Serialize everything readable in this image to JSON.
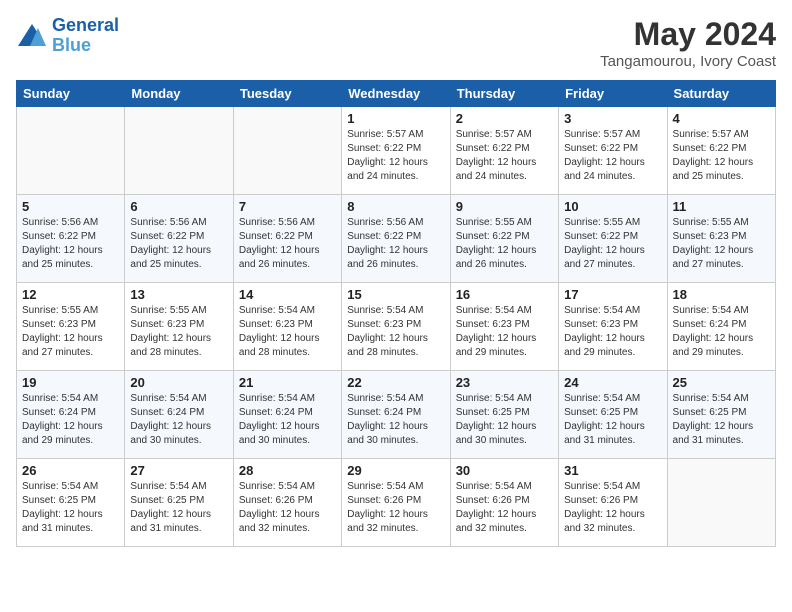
{
  "logo": {
    "line1": "General",
    "line2": "Blue"
  },
  "title": {
    "month_year": "May 2024",
    "location": "Tangamourou, Ivory Coast"
  },
  "weekdays": [
    "Sunday",
    "Monday",
    "Tuesday",
    "Wednesday",
    "Thursday",
    "Friday",
    "Saturday"
  ],
  "weeks": [
    [
      {
        "day": "",
        "sunrise": "",
        "sunset": "",
        "daylight": ""
      },
      {
        "day": "",
        "sunrise": "",
        "sunset": "",
        "daylight": ""
      },
      {
        "day": "",
        "sunrise": "",
        "sunset": "",
        "daylight": ""
      },
      {
        "day": "1",
        "sunrise": "Sunrise: 5:57 AM",
        "sunset": "Sunset: 6:22 PM",
        "daylight": "Daylight: 12 hours and 24 minutes."
      },
      {
        "day": "2",
        "sunrise": "Sunrise: 5:57 AM",
        "sunset": "Sunset: 6:22 PM",
        "daylight": "Daylight: 12 hours and 24 minutes."
      },
      {
        "day": "3",
        "sunrise": "Sunrise: 5:57 AM",
        "sunset": "Sunset: 6:22 PM",
        "daylight": "Daylight: 12 hours and 24 minutes."
      },
      {
        "day": "4",
        "sunrise": "Sunrise: 5:57 AM",
        "sunset": "Sunset: 6:22 PM",
        "daylight": "Daylight: 12 hours and 25 minutes."
      }
    ],
    [
      {
        "day": "5",
        "sunrise": "Sunrise: 5:56 AM",
        "sunset": "Sunset: 6:22 PM",
        "daylight": "Daylight: 12 hours and 25 minutes."
      },
      {
        "day": "6",
        "sunrise": "Sunrise: 5:56 AM",
        "sunset": "Sunset: 6:22 PM",
        "daylight": "Daylight: 12 hours and 25 minutes."
      },
      {
        "day": "7",
        "sunrise": "Sunrise: 5:56 AM",
        "sunset": "Sunset: 6:22 PM",
        "daylight": "Daylight: 12 hours and 26 minutes."
      },
      {
        "day": "8",
        "sunrise": "Sunrise: 5:56 AM",
        "sunset": "Sunset: 6:22 PM",
        "daylight": "Daylight: 12 hours and 26 minutes."
      },
      {
        "day": "9",
        "sunrise": "Sunrise: 5:55 AM",
        "sunset": "Sunset: 6:22 PM",
        "daylight": "Daylight: 12 hours and 26 minutes."
      },
      {
        "day": "10",
        "sunrise": "Sunrise: 5:55 AM",
        "sunset": "Sunset: 6:22 PM",
        "daylight": "Daylight: 12 hours and 27 minutes."
      },
      {
        "day": "11",
        "sunrise": "Sunrise: 5:55 AM",
        "sunset": "Sunset: 6:23 PM",
        "daylight": "Daylight: 12 hours and 27 minutes."
      }
    ],
    [
      {
        "day": "12",
        "sunrise": "Sunrise: 5:55 AM",
        "sunset": "Sunset: 6:23 PM",
        "daylight": "Daylight: 12 hours and 27 minutes."
      },
      {
        "day": "13",
        "sunrise": "Sunrise: 5:55 AM",
        "sunset": "Sunset: 6:23 PM",
        "daylight": "Daylight: 12 hours and 28 minutes."
      },
      {
        "day": "14",
        "sunrise": "Sunrise: 5:54 AM",
        "sunset": "Sunset: 6:23 PM",
        "daylight": "Daylight: 12 hours and 28 minutes."
      },
      {
        "day": "15",
        "sunrise": "Sunrise: 5:54 AM",
        "sunset": "Sunset: 6:23 PM",
        "daylight": "Daylight: 12 hours and 28 minutes."
      },
      {
        "day": "16",
        "sunrise": "Sunrise: 5:54 AM",
        "sunset": "Sunset: 6:23 PM",
        "daylight": "Daylight: 12 hours and 29 minutes."
      },
      {
        "day": "17",
        "sunrise": "Sunrise: 5:54 AM",
        "sunset": "Sunset: 6:23 PM",
        "daylight": "Daylight: 12 hours and 29 minutes."
      },
      {
        "day": "18",
        "sunrise": "Sunrise: 5:54 AM",
        "sunset": "Sunset: 6:24 PM",
        "daylight": "Daylight: 12 hours and 29 minutes."
      }
    ],
    [
      {
        "day": "19",
        "sunrise": "Sunrise: 5:54 AM",
        "sunset": "Sunset: 6:24 PM",
        "daylight": "Daylight: 12 hours and 29 minutes."
      },
      {
        "day": "20",
        "sunrise": "Sunrise: 5:54 AM",
        "sunset": "Sunset: 6:24 PM",
        "daylight": "Daylight: 12 hours and 30 minutes."
      },
      {
        "day": "21",
        "sunrise": "Sunrise: 5:54 AM",
        "sunset": "Sunset: 6:24 PM",
        "daylight": "Daylight: 12 hours and 30 minutes."
      },
      {
        "day": "22",
        "sunrise": "Sunrise: 5:54 AM",
        "sunset": "Sunset: 6:24 PM",
        "daylight": "Daylight: 12 hours and 30 minutes."
      },
      {
        "day": "23",
        "sunrise": "Sunrise: 5:54 AM",
        "sunset": "Sunset: 6:25 PM",
        "daylight": "Daylight: 12 hours and 30 minutes."
      },
      {
        "day": "24",
        "sunrise": "Sunrise: 5:54 AM",
        "sunset": "Sunset: 6:25 PM",
        "daylight": "Daylight: 12 hours and 31 minutes."
      },
      {
        "day": "25",
        "sunrise": "Sunrise: 5:54 AM",
        "sunset": "Sunset: 6:25 PM",
        "daylight": "Daylight: 12 hours and 31 minutes."
      }
    ],
    [
      {
        "day": "26",
        "sunrise": "Sunrise: 5:54 AM",
        "sunset": "Sunset: 6:25 PM",
        "daylight": "Daylight: 12 hours and 31 minutes."
      },
      {
        "day": "27",
        "sunrise": "Sunrise: 5:54 AM",
        "sunset": "Sunset: 6:25 PM",
        "daylight": "Daylight: 12 hours and 31 minutes."
      },
      {
        "day": "28",
        "sunrise": "Sunrise: 5:54 AM",
        "sunset": "Sunset: 6:26 PM",
        "daylight": "Daylight: 12 hours and 32 minutes."
      },
      {
        "day": "29",
        "sunrise": "Sunrise: 5:54 AM",
        "sunset": "Sunset: 6:26 PM",
        "daylight": "Daylight: 12 hours and 32 minutes."
      },
      {
        "day": "30",
        "sunrise": "Sunrise: 5:54 AM",
        "sunset": "Sunset: 6:26 PM",
        "daylight": "Daylight: 12 hours and 32 minutes."
      },
      {
        "day": "31",
        "sunrise": "Sunrise: 5:54 AM",
        "sunset": "Sunset: 6:26 PM",
        "daylight": "Daylight: 12 hours and 32 minutes."
      },
      {
        "day": "",
        "sunrise": "",
        "sunset": "",
        "daylight": ""
      }
    ]
  ]
}
